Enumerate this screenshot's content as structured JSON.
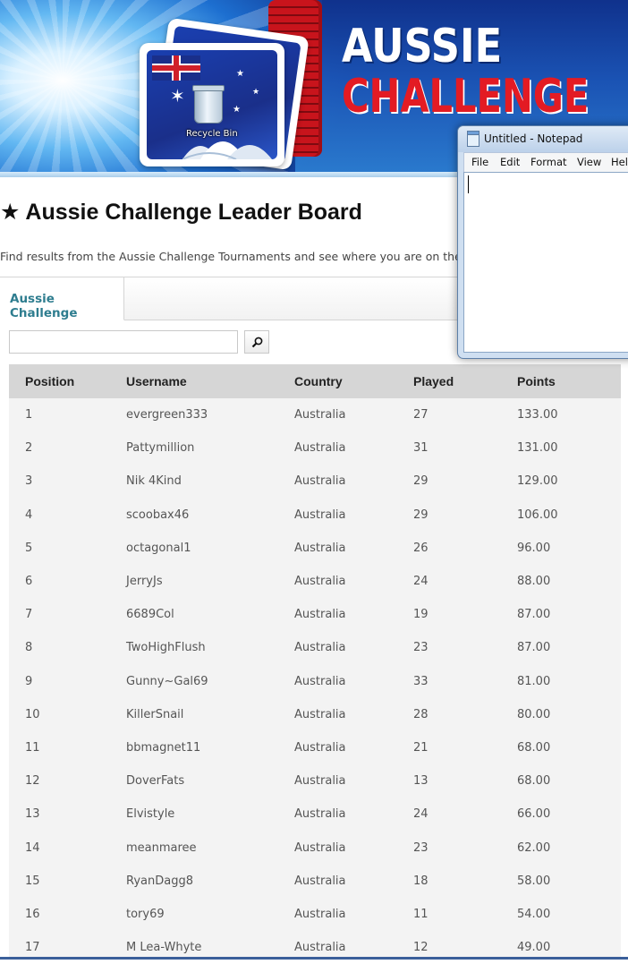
{
  "banner": {
    "title_line1": "AUSSIE",
    "title_line2": "CHALLENGE",
    "desktop_icon_label": "Recycle Bin"
  },
  "page": {
    "heading": "Aussie Challenge Leader Board",
    "heading_icon": "★",
    "intro": "Find results from the Aussie Challenge Tournaments and see where you are on the"
  },
  "tabs": [
    {
      "label": "Aussie Challenge",
      "active": true
    }
  ],
  "search": {
    "value": "",
    "button_icon": "search-icon"
  },
  "table": {
    "columns": [
      "Position",
      "Username",
      "Country",
      "Played",
      "Points"
    ],
    "rows": [
      [
        "1",
        "evergreen333",
        "Australia",
        "27",
        "133.00"
      ],
      [
        "2",
        "Pattymillion",
        "Australia",
        "31",
        "131.00"
      ],
      [
        "3",
        "Nik 4Kind",
        "Australia",
        "29",
        "129.00"
      ],
      [
        "4",
        "scoobax46",
        "Australia",
        "29",
        "106.00"
      ],
      [
        "5",
        "octagonal1",
        "Australia",
        "26",
        "96.00"
      ],
      [
        "6",
        "JerryJs",
        "Australia",
        "24",
        "88.00"
      ],
      [
        "7",
        "6689Col",
        "Australia",
        "19",
        "87.00"
      ],
      [
        "8",
        "TwoHighFlush",
        "Australia",
        "23",
        "87.00"
      ],
      [
        "9",
        "Gunny~Gal69",
        "Australia",
        "33",
        "81.00"
      ],
      [
        "10",
        "KillerSnail",
        "Australia",
        "28",
        "80.00"
      ],
      [
        "11",
        "bbmagnet11",
        "Australia",
        "21",
        "68.00"
      ],
      [
        "12",
        "DoverFats",
        "Australia",
        "13",
        "68.00"
      ],
      [
        "13",
        "Elvistyle",
        "Australia",
        "24",
        "66.00"
      ],
      [
        "14",
        "meanmaree",
        "Australia",
        "23",
        "62.00"
      ],
      [
        "15",
        "RyanDagg8",
        "Australia",
        "18",
        "58.00"
      ],
      [
        "16",
        "tory69",
        "Australia",
        "11",
        "54.00"
      ],
      [
        "17",
        "M Lea-Whyte",
        "Australia",
        "12",
        "49.00"
      ]
    ]
  },
  "notepad": {
    "title": "Untitled - Notepad",
    "menu": [
      "File",
      "Edit",
      "Format",
      "View",
      "Help"
    ],
    "content": ""
  },
  "colors": {
    "tab_text": "#2e7d8f",
    "header_bg": "#d6d6d6",
    "table_bg": "#f3f3f3",
    "banner_red": "#e31b23"
  }
}
